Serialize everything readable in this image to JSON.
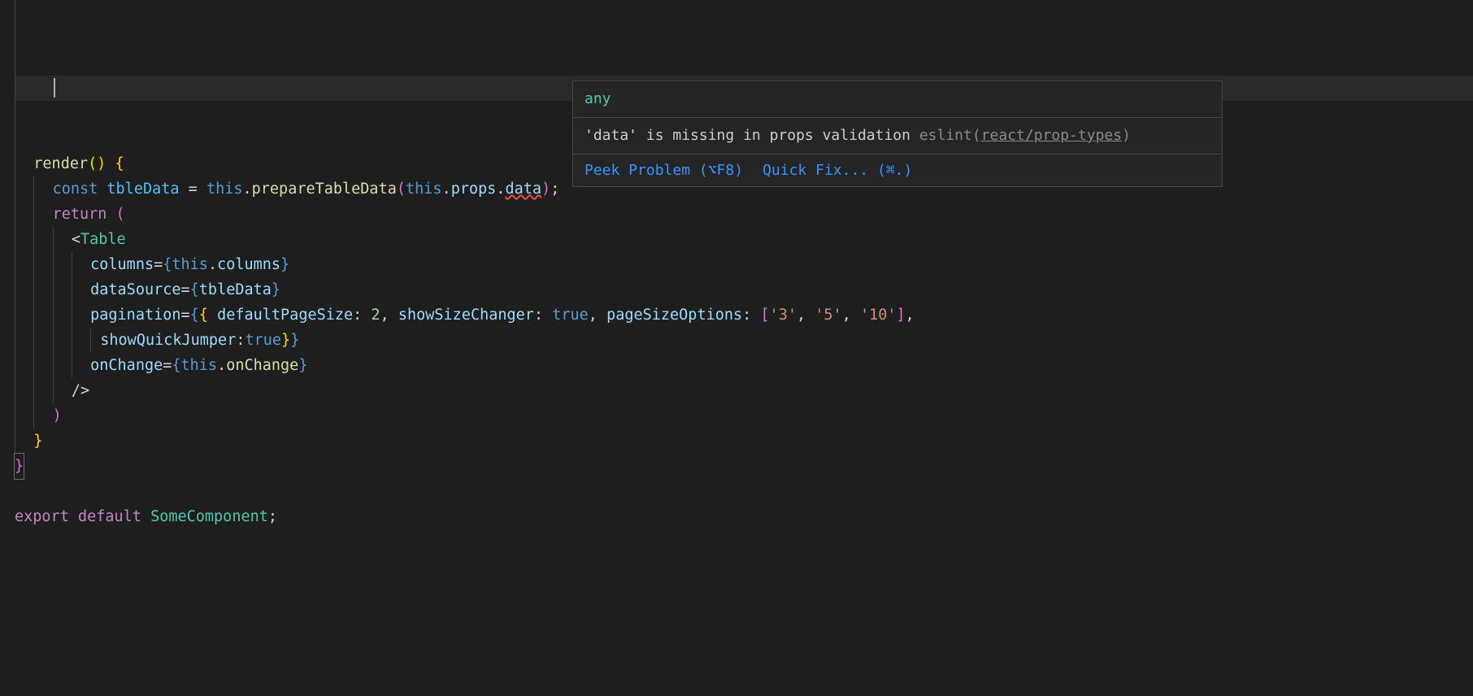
{
  "hover": {
    "type": "any",
    "message": "'data' is missing in props validation",
    "source": "eslint",
    "rule": "react/prop-types",
    "actions": {
      "peek": "Peek Problem (⌥F8)",
      "quickfix": "Quick Fix... (⌘.)"
    }
  },
  "code": {
    "render": "render",
    "const": "const",
    "tbleData": "tbleData",
    "eq": " = ",
    "this": "this",
    "prepareTableData": "prepareTableData",
    "props": "props",
    "data": "data",
    "return": "return",
    "Table": "Table",
    "columns_attr": "columns",
    "columns_prop": "columns",
    "dataSource_attr": "dataSource",
    "pagination_attr": "pagination",
    "defaultPageSize": "defaultPageSize",
    "two": "2",
    "showSizeChanger": "showSizeChanger",
    "true": "true",
    "pageSizeOptions": "pageSizeOptions",
    "opt3": "'3'",
    "opt5": "'5'",
    "opt10": "'10'",
    "showQuickJumper": "showQuickJumper",
    "onChange_attr": "onChange",
    "onChange_prop": "onChange",
    "export": "export",
    "default": "default",
    "SomeComponent": "SomeComponent"
  }
}
